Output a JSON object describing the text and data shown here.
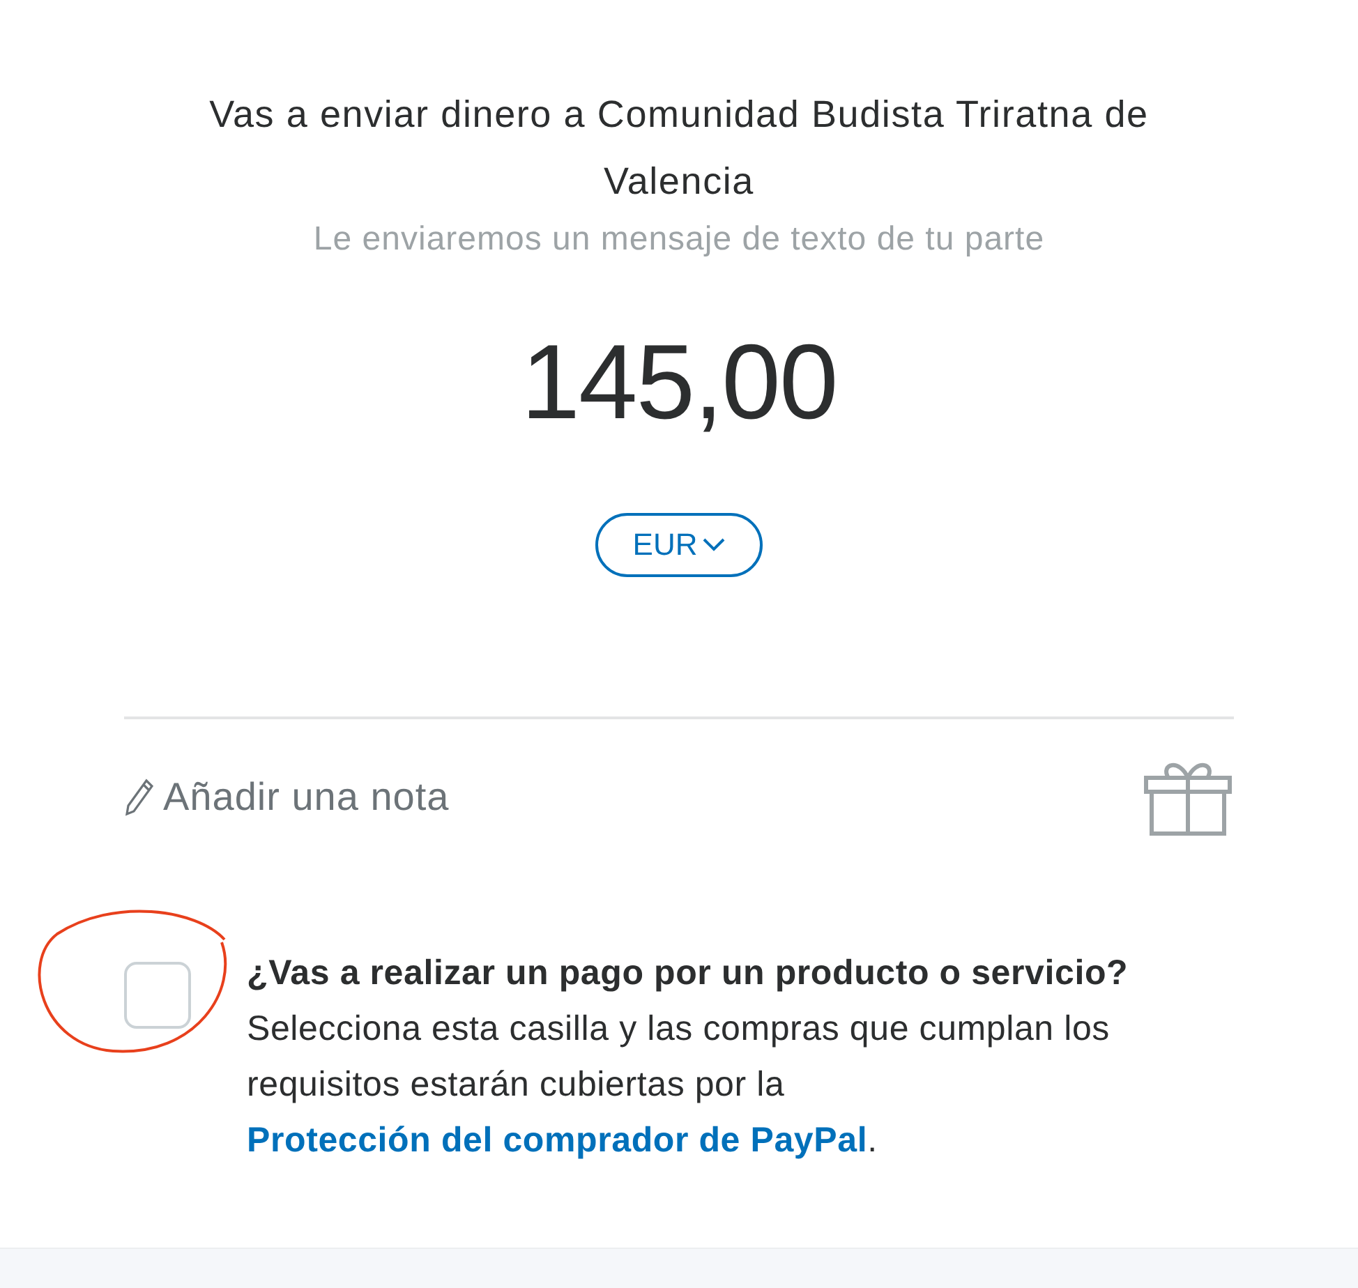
{
  "header": {
    "title": "Vas a enviar dinero a Comunidad Budista Triratna de Valencia",
    "subtitle": "Le enviaremos un mensaje de texto de tu parte"
  },
  "amount": "145,00",
  "currency": {
    "label": "EUR"
  },
  "note": {
    "label": "Añadir una nota"
  },
  "purchase": {
    "checked": false,
    "text": "**¿Vas a realizar un pago por un producto o servicio?** Selecciona esta casilla y las compras que cumplan los requisitos estarán cubiertas por la ",
    "link": "Protección del comprador de PayPal",
    "after": "."
  }
}
